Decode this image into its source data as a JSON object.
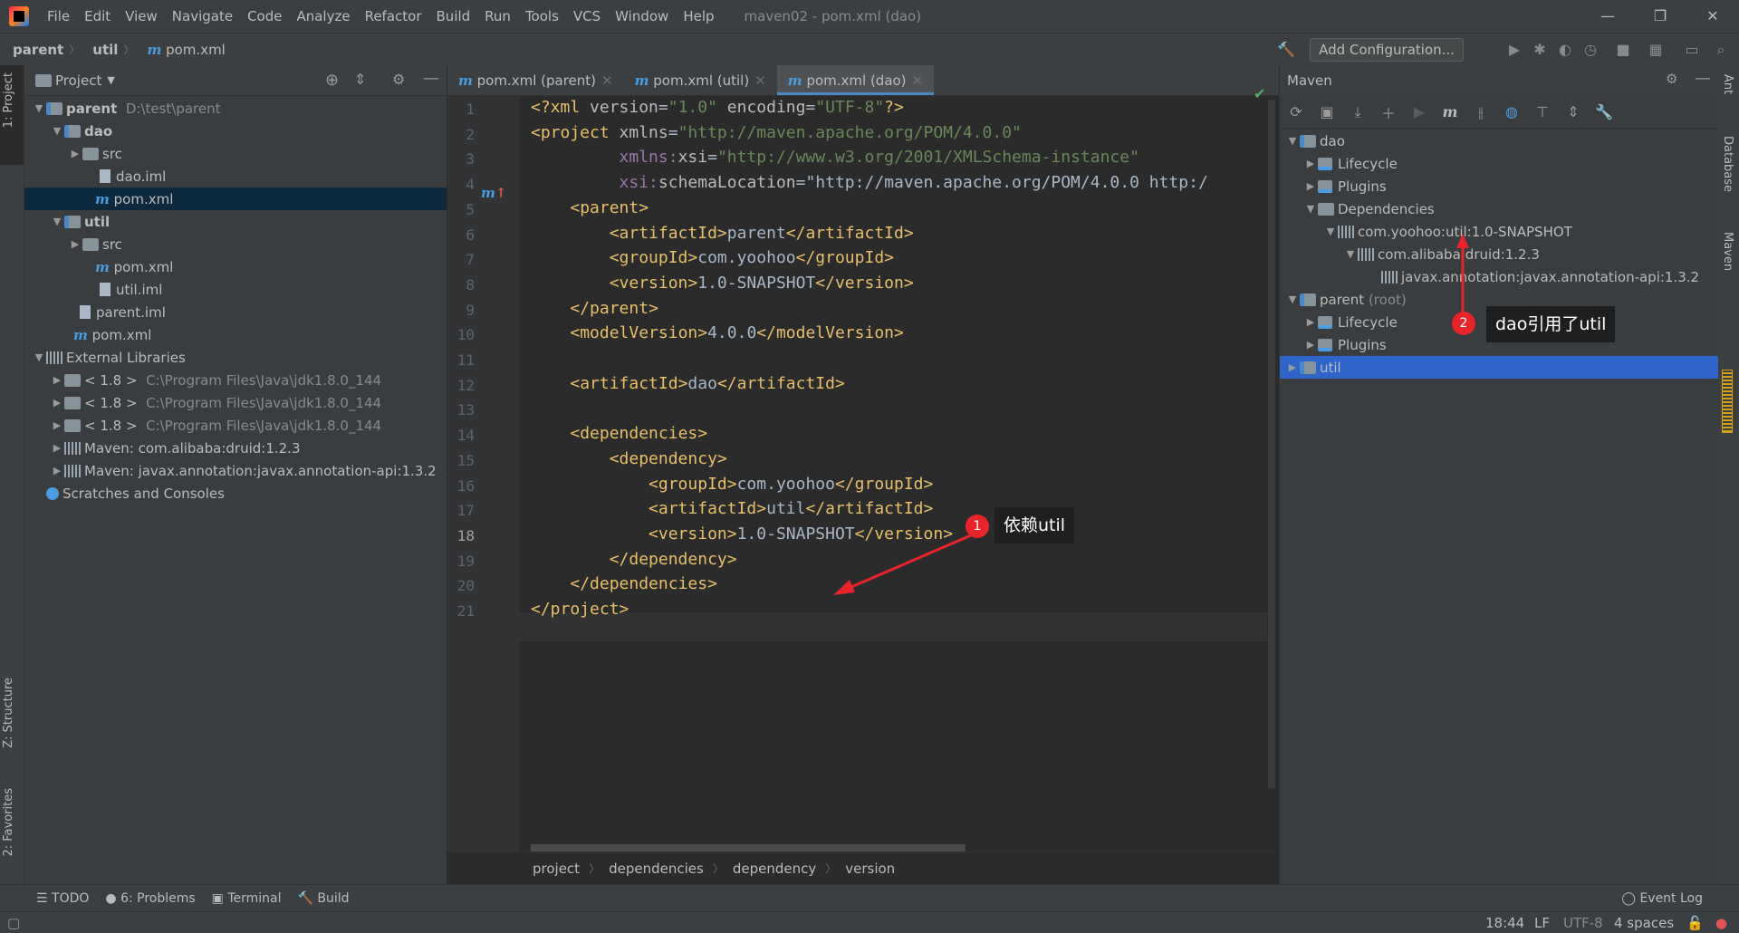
{
  "menubar": {
    "items": [
      "File",
      "Edit",
      "View",
      "Navigate",
      "Code",
      "Analyze",
      "Refactor",
      "Build",
      "Run",
      "Tools",
      "VCS",
      "Window",
      "Help"
    ],
    "window_title": "maven02 - pom.xml (dao)"
  },
  "navbar": {
    "crumbs": [
      "parent",
      "util",
      "pom.xml"
    ],
    "add_config": "Add Configuration..."
  },
  "left_stripe": {
    "project": "1: Project",
    "structure": "Z: Structure",
    "favorites": "2: Favorites"
  },
  "project_panel": {
    "title": "Project",
    "tree": [
      {
        "label": "parent",
        "extra": "D:\\test\\parent"
      },
      {
        "label": "dao"
      },
      {
        "label": "src"
      },
      {
        "label": "dao.iml"
      },
      {
        "label": "pom.xml"
      },
      {
        "label": "util"
      },
      {
        "label": "src"
      },
      {
        "label": "pom.xml"
      },
      {
        "label": "util.iml"
      },
      {
        "label": "parent.iml"
      },
      {
        "label": "pom.xml"
      },
      {
        "label": "External Libraries"
      },
      {
        "label": "< 1.8 >",
        "extra": "C:\\Program Files\\Java\\jdk1.8.0_144"
      },
      {
        "label": "< 1.8 >",
        "extra": "C:\\Program Files\\Java\\jdk1.8.0_144"
      },
      {
        "label": "< 1.8 >",
        "extra": "C:\\Program Files\\Java\\jdk1.8.0_144"
      },
      {
        "label": "Maven: com.alibaba:druid:1.2.3"
      },
      {
        "label": "Maven: javax.annotation:javax.annotation-api:1.3.2"
      },
      {
        "label": "Scratches and Consoles"
      }
    ]
  },
  "editor": {
    "tabs": [
      "pom.xml (parent)",
      "pom.xml (util)",
      "pom.xml (dao)"
    ],
    "active_tab": "pom.xml (dao)",
    "lines": [
      "<?xml version=\"1.0\" encoding=\"UTF-8\"?>",
      "<project xmlns=\"http://maven.apache.org/POM/4.0.0\"",
      "         xmlns:xsi=\"http://www.w3.org/2001/XMLSchema-instance\"",
      "         xsi:schemaLocation=\"http://maven.apache.org/POM/4.0.0 http:/",
      "    <parent>",
      "        <artifactId>parent</artifactId>",
      "        <groupId>com.yoohoo</groupId>",
      "        <version>1.0-SNAPSHOT</version>",
      "    </parent>",
      "    <modelVersion>4.0.0</modelVersion>",
      "",
      "    <artifactId>dao</artifactId>",
      "",
      "    <dependencies>",
      "        <dependency>",
      "            <groupId>com.yoohoo</groupId>",
      "            <artifactId>util</artifactId>",
      "            <version>1.0-SNAPSHOT</version>",
      "        </dependency>",
      "    </dependencies>",
      "</project>"
    ],
    "current_line": 18,
    "breadcrumb": [
      "project",
      "dependencies",
      "dependency",
      "version"
    ]
  },
  "maven_panel": {
    "title": "Maven",
    "tree": [
      {
        "label": "dao"
      },
      {
        "label": "Lifecycle"
      },
      {
        "label": "Plugins"
      },
      {
        "label": "Dependencies"
      },
      {
        "label": "com.yoohoo:util:1.0-SNAPSHOT"
      },
      {
        "label": "com.alibaba:druid:1.2.3"
      },
      {
        "label": "javax.annotation:javax.annotation-api:1.3.2"
      },
      {
        "label": "parent",
        "extra": "(root)"
      },
      {
        "label": "Lifecycle"
      },
      {
        "label": "Plugins"
      },
      {
        "label": "util"
      }
    ]
  },
  "right_stripe": {
    "ant": "Ant",
    "database": "Database",
    "maven": "Maven"
  },
  "annotations": [
    {
      "number": "1",
      "text": "依赖util"
    },
    {
      "number": "2",
      "text": "dao引用了util"
    }
  ],
  "toolwindows": [
    "TODO",
    "6: Problems",
    "Terminal",
    "Build",
    "Event Log"
  ],
  "status": {
    "position": "18:44",
    "line_sep": "LF",
    "encoding": "UTF-8",
    "indent": "4 spaces"
  },
  "colors": {
    "accent": "#4a88c7",
    "selection": "#2f65ca",
    "tag": "#e8bf6a",
    "string": "#6a8759",
    "annotation": "#e8242b"
  }
}
